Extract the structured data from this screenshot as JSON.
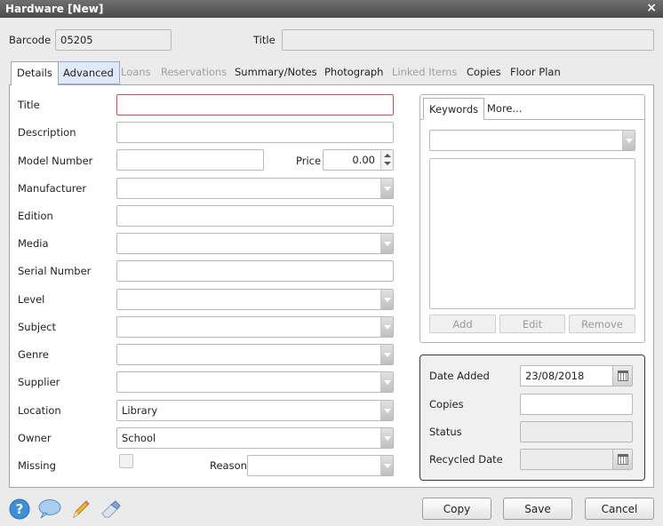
{
  "window": {
    "title": "Hardware [New]",
    "close_glyph": "×"
  },
  "header": {
    "barcode_label": "Barcode",
    "barcode_value": "05205",
    "title_label": "Title",
    "title_value": ""
  },
  "tabs": [
    {
      "label": "Details"
    },
    {
      "label": "Advanced"
    },
    {
      "label": "Loans"
    },
    {
      "label": "Reservations"
    },
    {
      "label": "Summary/Notes"
    },
    {
      "label": "Photograph"
    },
    {
      "label": "Linked Items"
    },
    {
      "label": "Copies"
    },
    {
      "label": "Floor Plan"
    }
  ],
  "details": {
    "title_label": "Title",
    "title_value": "",
    "description_label": "Description",
    "description_value": "",
    "model_number_label": "Model Number",
    "model_number_value": "",
    "price_label": "Price",
    "price_value": "0.00",
    "manufacturer_label": "Manufacturer",
    "manufacturer_value": "",
    "edition_label": "Edition",
    "edition_value": "",
    "media_label": "Media",
    "media_value": "",
    "serial_number_label": "Serial Number",
    "serial_number_value": "",
    "level_label": "Level",
    "level_value": "",
    "subject_label": "Subject",
    "subject_value": "",
    "genre_label": "Genre",
    "genre_value": "",
    "supplier_label": "Supplier",
    "supplier_value": "",
    "location_label": "Location",
    "location_value": "Library",
    "owner_label": "Owner",
    "owner_value": "School",
    "missing_label": "Missing",
    "reason_label": "Reason",
    "reason_value": ""
  },
  "keywords": {
    "tab_keywords": "Keywords",
    "tab_more": "More...",
    "select_value": "",
    "add_label": "Add",
    "edit_label": "Edit",
    "remove_label": "Remove"
  },
  "dates": {
    "date_added_label": "Date Added",
    "date_added_value": "23/08/2018",
    "copies_label": "Copies",
    "copies_value": "",
    "status_label": "Status",
    "status_value": "",
    "recycled_date_label": "Recycled Date",
    "recycled_date_value": ""
  },
  "footer": {
    "copy_label": "Copy",
    "save_label": "Save",
    "cancel_label": "Cancel"
  },
  "icons": [
    "help-icon",
    "comment-icon",
    "pencil-icon",
    "eraser-icon"
  ]
}
